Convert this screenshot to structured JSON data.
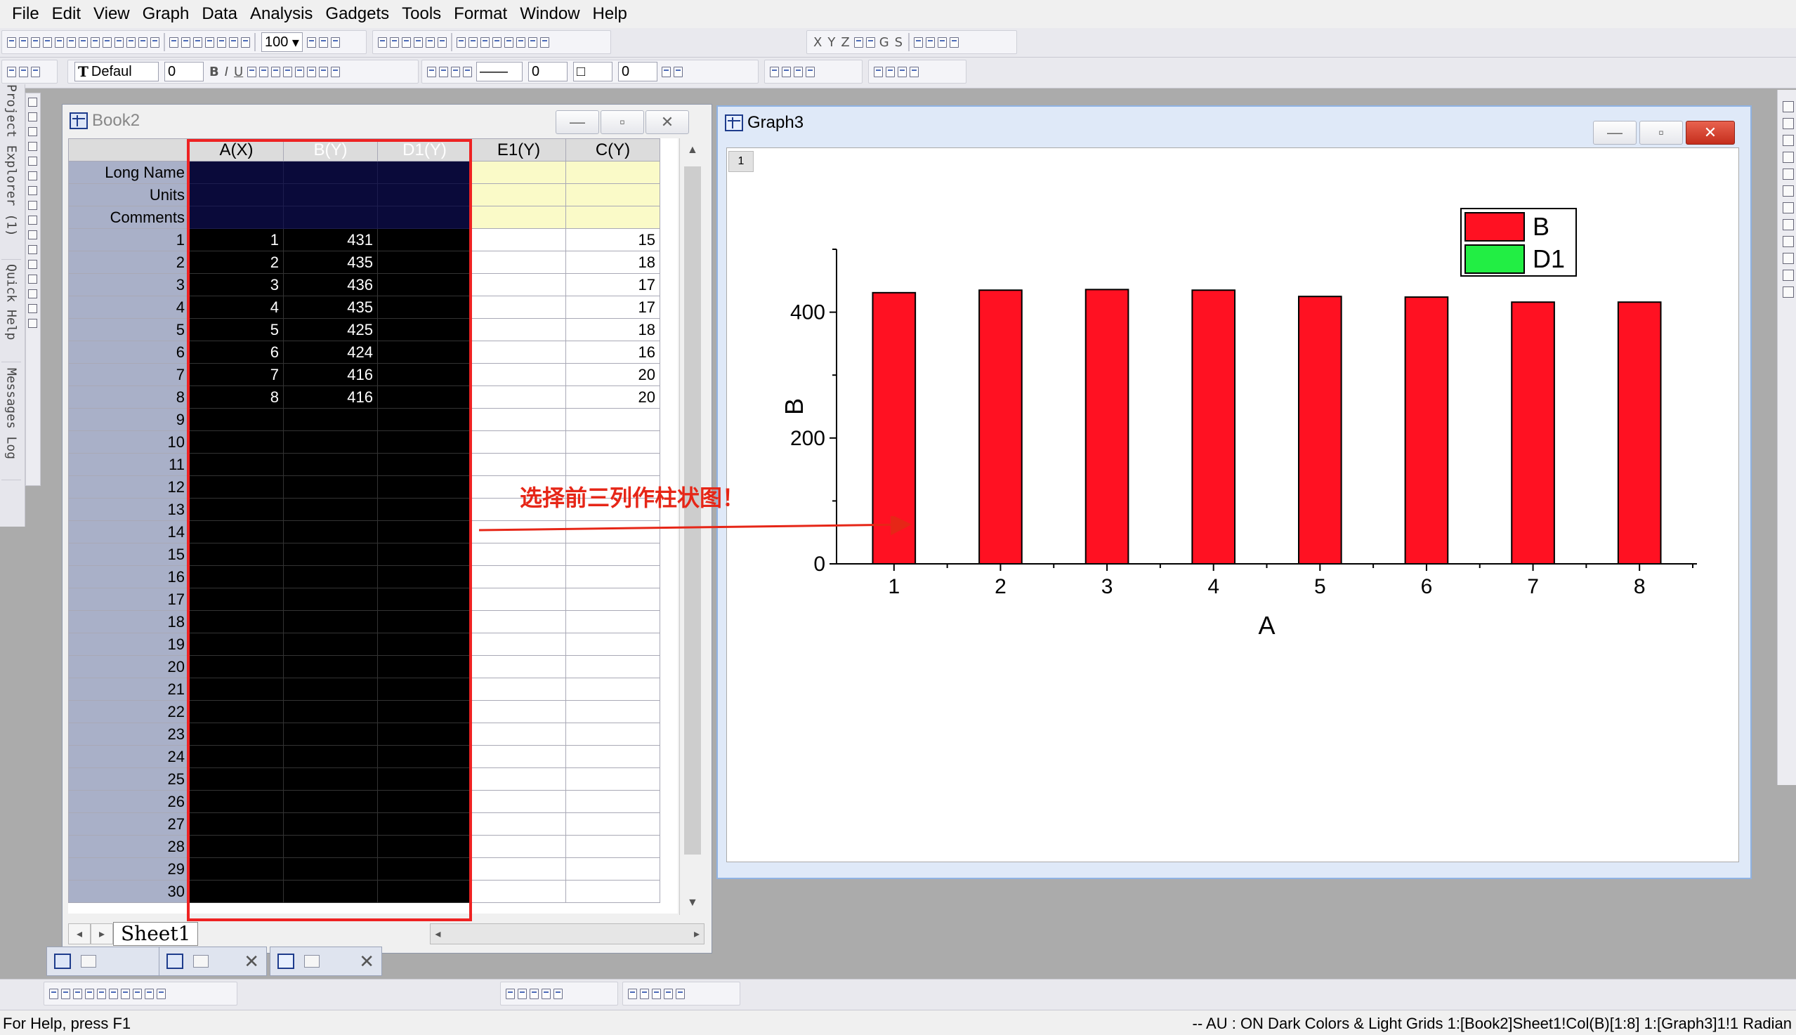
{
  "menu": [
    "File",
    "Edit",
    "View",
    "Graph",
    "Data",
    "Analysis",
    "Gadgets",
    "Tools",
    "Format",
    "Window",
    "Help"
  ],
  "toolbar": {
    "zoom_value": "100",
    "font_name": "Defaul",
    "font_size": "0",
    "line_width": "0",
    "fill_value": "0",
    "axis_letters": [
      "X",
      "Y",
      "Z"
    ],
    "gs_letters": [
      "G",
      "S"
    ]
  },
  "dock": {
    "project_explorer": "Project Explorer (1)",
    "quick_help": "Quick Help",
    "messages_log": "Messages Log"
  },
  "book": {
    "title": "Book2",
    "columns": [
      "A(X)",
      "B(Y)",
      "D1(Y)",
      "E1(Y)",
      "C(Y)"
    ],
    "meta_labels": [
      "Long Name",
      "Units",
      "Comments"
    ],
    "row_numbers": [
      "1",
      "2",
      "3",
      "4",
      "5",
      "6",
      "7",
      "8",
      "9",
      "10",
      "11",
      "12",
      "13",
      "14",
      "15",
      "16",
      "17",
      "18",
      "19",
      "20",
      "21",
      "22",
      "23",
      "24",
      "25",
      "26",
      "27",
      "28",
      "29",
      "30"
    ],
    "col_a": [
      "1",
      "2",
      "3",
      "4",
      "5",
      "6",
      "7",
      "8"
    ],
    "col_b": [
      "431",
      "435",
      "436",
      "435",
      "425",
      "424",
      "416",
      "416"
    ],
    "col_c": [
      "15",
      "18",
      "17",
      "17",
      "18",
      "16",
      "20",
      "20"
    ],
    "sheet_tab": "Sheet1"
  },
  "graph": {
    "title": "Graph3",
    "layer_tag": "1"
  },
  "chart_data": {
    "type": "bar",
    "categories": [
      "1",
      "2",
      "3",
      "4",
      "5",
      "6",
      "7",
      "8"
    ],
    "series": [
      {
        "name": "B",
        "values": [
          431,
          435,
          436,
          435,
          425,
          424,
          416,
          416
        ],
        "color": "#ff1122"
      },
      {
        "name": "D1",
        "values": [],
        "color": "#22ee44"
      }
    ],
    "xlabel": "A",
    "ylabel": "B",
    "ylim": [
      0,
      500
    ],
    "yticks": [
      0,
      200,
      400
    ],
    "yticks_labels": [
      "0",
      "200",
      "400"
    ],
    "legend": "top-right"
  },
  "annotation": "选择前三列作柱状图！",
  "status": {
    "left": "For Help, press F1",
    "right": "-- AU : ON Dark Colors & Light Grids 1:[Book2]Sheet1!Col(B)[1:8] 1:[Graph3]1!1 Radian"
  },
  "colors": {
    "selection": "#000000",
    "selection_border": "#ee2222",
    "annotation": "#e62617",
    "bar_fill": "#ff1122"
  }
}
